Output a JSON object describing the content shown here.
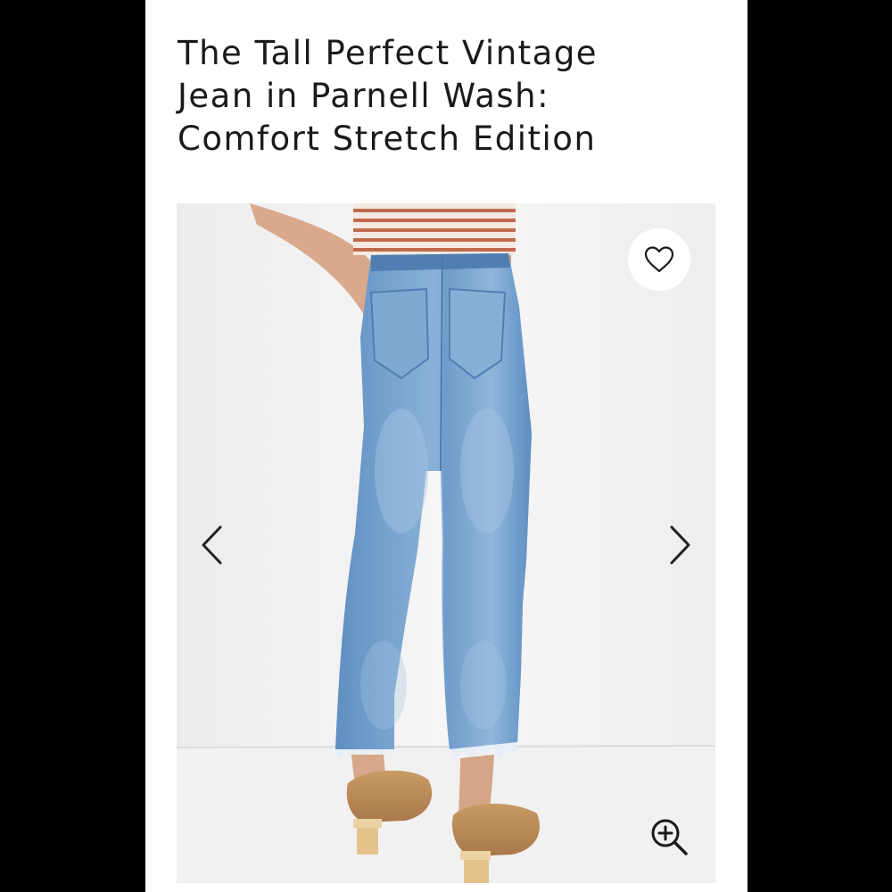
{
  "product": {
    "title_lines": [
      "The Tall Perfect Vintage",
      "Jean in Parnell Wash:",
      "Comfort Stretch Edition"
    ]
  },
  "gallery": {
    "image_alt": "The Tall Perfect Vintage Jean in Parnell Wash: Comfort Stretch Edition",
    "favorite_icon": "heart-outline-icon",
    "prev_icon": "chevron-left-icon",
    "next_icon": "chevron-right-icon",
    "zoom_icon": "zoom-in-icon"
  },
  "colors": {
    "page_background": "#000000",
    "panel_background": "#ffffff",
    "denim": "#6f9cc9",
    "text": "#1a1a1a"
  }
}
